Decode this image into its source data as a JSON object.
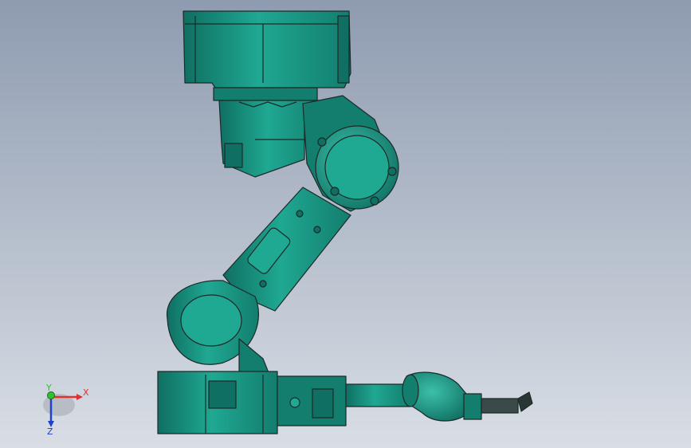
{
  "viewport": {
    "background_top": "#8e9bb0",
    "background_bottom": "#d9dee5",
    "model_color": "#1a9a86",
    "model_color_dark": "#0f6f62",
    "model_color_light": "#3cc0aa",
    "edge_color": "#1c2a28"
  },
  "model": {
    "parts": [
      "base-motor-housing",
      "base-turret",
      "shoulder-joint",
      "upper-arm",
      "elbow-joint",
      "forearm-motor-housing",
      "forearm-tube",
      "wrist-joint",
      "tool-flange"
    ]
  },
  "triad": {
    "x_label": "X",
    "y_label": "Y",
    "z_label": "Z",
    "x_color": "#e03030",
    "y_color": "#30c030",
    "z_color": "#2040d0"
  }
}
